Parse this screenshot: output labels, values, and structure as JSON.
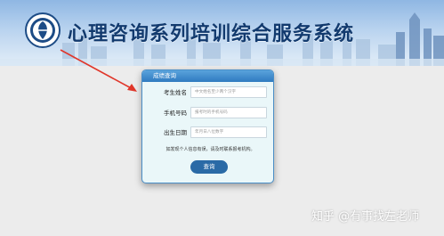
{
  "header": {
    "title": "心理咨询系列培训综合服务系统"
  },
  "panel": {
    "title": "成绩查询",
    "fields": {
      "name": {
        "label": "考生姓名",
        "placeholder": "中文姓名至少两个汉字"
      },
      "phone": {
        "label": "手机号码",
        "placeholder": "报考时的手机号码"
      },
      "birth": {
        "label": "出生日期",
        "placeholder": "年月日八位数字"
      }
    },
    "notice": "如发现个人信息有误，请及时联系报考机构。",
    "query_button": "查询"
  },
  "watermark": "知乎 @有事找左老师",
  "colors": {
    "accent": "#2a6aa6",
    "header_blue": "#2f7ac0",
    "arrow_red": "#e0362a",
    "title_blue": "#123a6e"
  }
}
